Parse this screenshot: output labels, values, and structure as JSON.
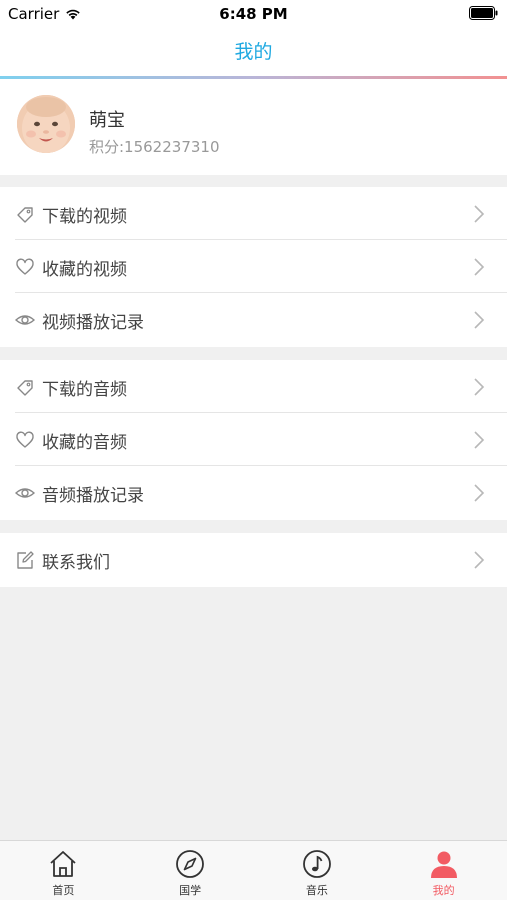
{
  "status_bar": {
    "carrier": "Carrier",
    "time": "6:48 PM"
  },
  "nav": {
    "title": "我的",
    "title_color": "#1fa9e1"
  },
  "profile": {
    "name": "萌宝",
    "points": "积分:1562237310"
  },
  "menu": {
    "video_group": [
      {
        "label": "下载的视频",
        "icon": "tag-icon"
      },
      {
        "label": "收藏的视频",
        "icon": "heart-icon"
      },
      {
        "label": "视频播放记录",
        "icon": "eye-icon"
      }
    ],
    "audio_group": [
      {
        "label": "下载的音频",
        "icon": "tag-icon"
      },
      {
        "label": "收藏的音频",
        "icon": "heart-icon"
      },
      {
        "label": "音频播放记录",
        "icon": "eye-icon"
      }
    ],
    "contact_group": [
      {
        "label": "联系我们",
        "icon": "edit-icon"
      }
    ]
  },
  "tab_bar": {
    "active_color": "#f25b63",
    "tabs": [
      {
        "label": "首页",
        "icon": "home-icon"
      },
      {
        "label": "国学",
        "icon": "compass-icon"
      },
      {
        "label": "音乐",
        "icon": "music-note-icon"
      },
      {
        "label": "我的",
        "icon": "person-icon",
        "active": true
      }
    ]
  }
}
